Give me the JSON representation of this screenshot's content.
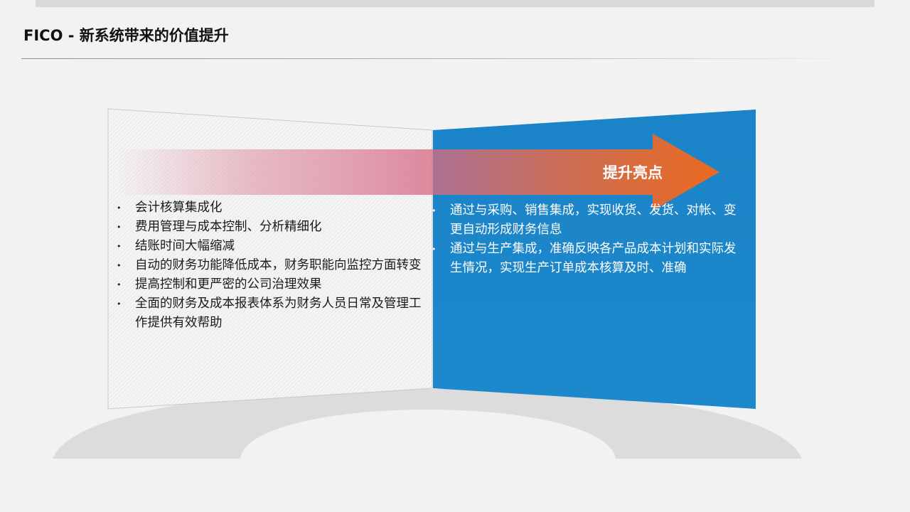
{
  "header": {
    "title": "FICO - 新系统带来的价值提升"
  },
  "arrow": {
    "label": "提升亮点"
  },
  "left_panel": {
    "items": [
      "会计核算集成化",
      "费用管理与成本控制、分析精细化",
      "结账时间大幅缩减",
      "自动的财务功能降低成本，财务职能向监控方面转变",
      "提高控制和更严密的公司治理效果",
      "全面的财务及成本报表体系为财务人员日常及管理工作提供有效帮助"
    ]
  },
  "right_panel": {
    "items": [
      "通过与采购、销售集成，实现收货、发货、对帐、变更自动形成财务信息",
      "通过与生产集成，准确反映各产品成本计划和实际发生情况，实现生产订单成本核算及时、准确"
    ]
  },
  "colors": {
    "panel_blue": "#1b84c8",
    "arrow_orange": "#ea6a1f",
    "arrow_pink": "#d9788e",
    "base_gray": "#dcdcdc",
    "background": "#f2f2f2"
  }
}
